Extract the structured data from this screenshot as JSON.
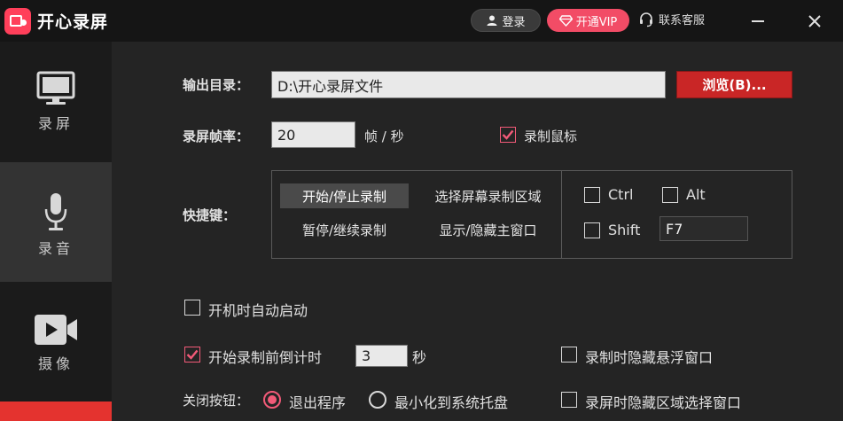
{
  "app": {
    "name": "开心录屏"
  },
  "titlebar": {
    "login": "登录",
    "vip": "开通VIP",
    "service": "联系客服"
  },
  "sidebar": {
    "items": [
      {
        "label": "录屏",
        "icon": "monitor-icon"
      },
      {
        "label": "录音",
        "icon": "microphone-icon",
        "active": true
      },
      {
        "label": "摄像",
        "icon": "video-camera-icon"
      }
    ]
  },
  "settings": {
    "output_dir_label": "输出目录：",
    "output_dir_value": "D:\\开心录屏文件",
    "browse_label": "浏览(B)...",
    "framerate_label": "录屏帧率：",
    "framerate_value": "20",
    "framerate_unit": "帧 / 秒",
    "record_mouse_label": "录制鼠标",
    "record_mouse_checked": true,
    "hotkey_label": "快捷键：",
    "hotkey_actions": [
      "开始/停止录制",
      "选择屏幕录制区域",
      "暂停/继续录制",
      "显示/隐藏主窗口"
    ],
    "hotkey_selected": "开始/停止录制",
    "modifiers": {
      "ctrl": "Ctrl",
      "alt": "Alt",
      "shift": "Shift"
    },
    "hotkey_key": "F7",
    "autostart_label": "开机时自动启动",
    "autostart_checked": false,
    "countdown_label": "开始录制前倒计时",
    "countdown_checked": true,
    "countdown_value": "3",
    "countdown_unit": "秒",
    "hide_float_label": "录制时隐藏悬浮窗口",
    "hide_region_label": "录屏时隐藏区域选择窗口",
    "close_label": "关闭按钮：",
    "close_options": [
      "退出程序",
      "最小化到系统托盘"
    ],
    "close_selected": "退出程序"
  },
  "colors": {
    "accent": "#f25a78",
    "vip": "#f24c66",
    "browse": "#c92626",
    "sidebar_active": "#333333"
  }
}
